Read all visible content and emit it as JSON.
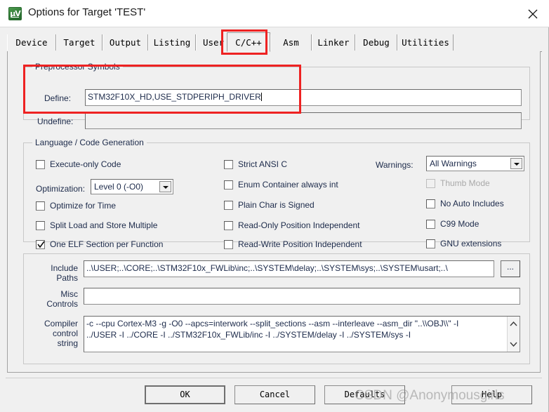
{
  "window": {
    "title": "Options for Target 'TEST'",
    "app_icon": "uvision-icon",
    "close_label": "✕"
  },
  "tabs": [
    {
      "label": "Device",
      "selected": false
    },
    {
      "label": "Target",
      "selected": false
    },
    {
      "label": "Output",
      "selected": false
    },
    {
      "label": "Listing",
      "selected": false
    },
    {
      "label": "User",
      "selected": false
    },
    {
      "label": "C/C++",
      "selected": true
    },
    {
      "label": "Asm",
      "selected": false
    },
    {
      "label": "Linker",
      "selected": false
    },
    {
      "label": "Debug",
      "selected": false
    },
    {
      "label": "Utilities",
      "selected": false
    }
  ],
  "preprocessor": {
    "group_label": "Preprocessor Symbols",
    "define_label": "Define:",
    "define_value": "STM32F10X_HD,USE_STDPERIPH_DRIVER",
    "undefine_label": "Undefine:",
    "undefine_value": ""
  },
  "language": {
    "group_label": "Language / Code Generation",
    "left_checks": [
      {
        "label": "Execute-only Code",
        "checked": false,
        "disabled": false
      },
      {
        "label": "Optimize for Time",
        "checked": false,
        "disabled": false
      },
      {
        "label": "Split Load and Store Multiple",
        "checked": false,
        "disabled": false
      },
      {
        "label": "One ELF Section per Function",
        "checked": true,
        "disabled": false
      }
    ],
    "optimization_label": "Optimization:",
    "optimization_value": "Level 0 (-O0)",
    "middle_checks": [
      {
        "label": "Strict ANSI C",
        "checked": false,
        "disabled": false
      },
      {
        "label": "Enum Container always int",
        "checked": false,
        "disabled": false
      },
      {
        "label": "Plain Char is Signed",
        "checked": false,
        "disabled": false
      },
      {
        "label": "Read-Only Position Independent",
        "checked": false,
        "disabled": false
      },
      {
        "label": "Read-Write Position Independent",
        "checked": false,
        "disabled": false
      }
    ],
    "warnings_label": "Warnings:",
    "warnings_value": "All Warnings",
    "right_checks": [
      {
        "label": "Thumb Mode",
        "checked": false,
        "disabled": true
      },
      {
        "label": "No Auto Includes",
        "checked": false,
        "disabled": false
      },
      {
        "label": "C99 Mode",
        "checked": false,
        "disabled": false
      },
      {
        "label": "GNU extensions",
        "checked": false,
        "disabled": false
      }
    ]
  },
  "paths": {
    "include_label_line1": "Include",
    "include_label_line2": "Paths",
    "include_value": "..\\USER;..\\CORE;..\\STM32F10x_FWLib\\inc;..\\SYSTEM\\delay;..\\SYSTEM\\sys;..\\SYSTEM\\usart;..\\",
    "browse_label": "...",
    "misc_label_line1": "Misc",
    "misc_label_line2": "Controls",
    "misc_value": "",
    "compiler_label_line1": "Compiler",
    "compiler_label_line2": "control",
    "compiler_label_line3": "string",
    "compiler_value_line1": "-c --cpu Cortex-M3 -g -O0 --apcs=interwork --split_sections --asm --interleave --asm_dir \"..\\\\OBJ\\\\\" -I",
    "compiler_value_line2": "../USER -I ../CORE -I ../STM32F10x_FWLib/inc -I ../SYSTEM/delay -I ../SYSTEM/sys -I"
  },
  "buttons": {
    "ok": "OK",
    "cancel": "Cancel",
    "defaults": "Defaults",
    "help": "Help"
  },
  "watermark": "CSDN @Anonymousgirls",
  "colors": {
    "highlight_red": "#ee2222",
    "dialog_bg": "#f0f0f0",
    "label_text": "#1c2a4a"
  }
}
